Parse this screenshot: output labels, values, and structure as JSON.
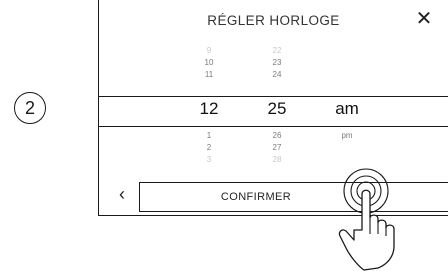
{
  "step": {
    "number": "2"
  },
  "dialog": {
    "title": "RÉGLER HORLOGE",
    "close_icon": "close-icon"
  },
  "picker": {
    "hours": {
      "above_faint": "9",
      "above": [
        "10",
        "11"
      ],
      "selected": "12",
      "below": [
        "1",
        "2"
      ],
      "below_faint": "3"
    },
    "minutes": {
      "above_faint": "22",
      "above": [
        "23",
        "24"
      ],
      "selected": "25",
      "below": [
        "26",
        "27"
      ],
      "below_faint": "28"
    },
    "period": {
      "selected": "am",
      "below": [
        "pm"
      ]
    }
  },
  "footer": {
    "back_icon": "chevron-left-icon",
    "confirm_label": "CONFIRMER"
  },
  "overlay": {
    "hand_icon": "tap-hand-icon"
  }
}
